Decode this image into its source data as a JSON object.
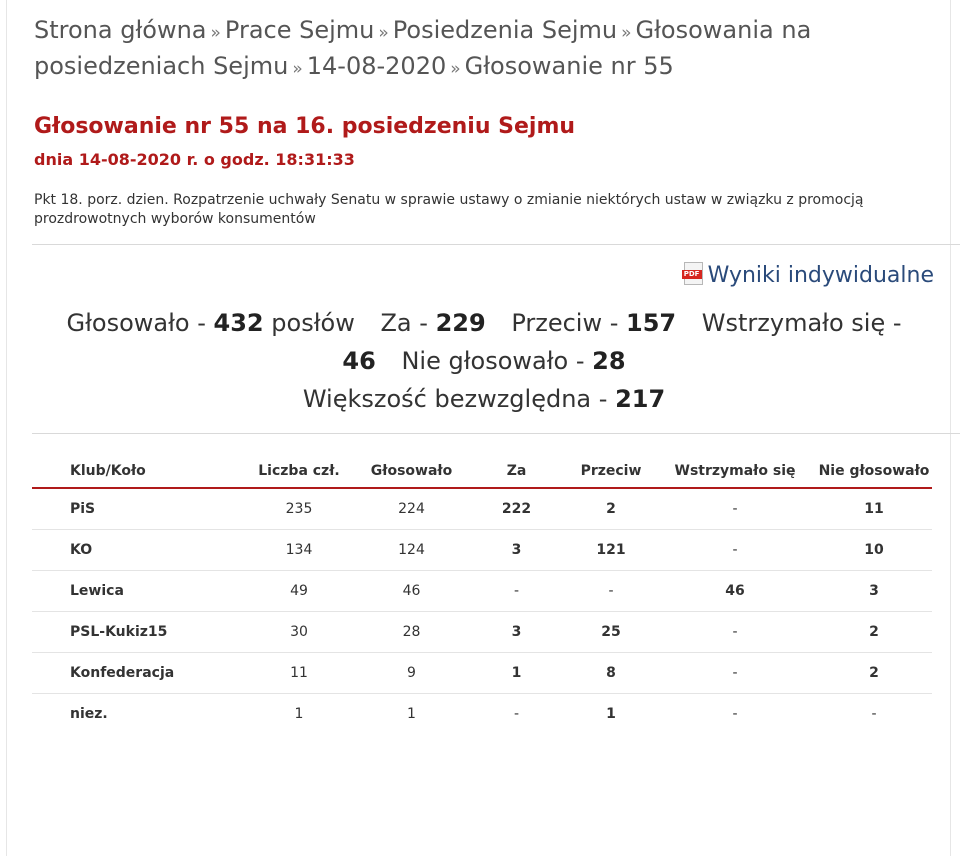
{
  "breadcrumb": {
    "items": [
      "Strona główna",
      "Prace Sejmu",
      "Posiedzenia Sejmu",
      "Głosowania na posiedzeniach Sejmu",
      "14-08-2020",
      "Głosowanie nr 55"
    ],
    "separator": "»"
  },
  "vote": {
    "title": "Głosowanie nr 55 na 16. posiedzeniu Sejmu",
    "date_line": "dnia 14-08-2020 r. o godz. 18:31:33",
    "description": "Pkt 18. porz. dzien. Rozpatrzenie uchwały Senatu w sprawie ustawy o zmianie niektórych ustaw w związku z promocją prozdrowotnych wyborów konsumentów"
  },
  "pdf_link": {
    "icon": "pdf-icon",
    "icon_text": "PDF",
    "label": "Wyniki indywidualne"
  },
  "summary": {
    "voted_label": "Głosowało -",
    "voted": "432",
    "voted_unit": "posłów",
    "for_label": "Za -",
    "for": "229",
    "against_label": "Przeciw -",
    "against": "157",
    "abstained_label": "Wstrzymało się -",
    "abstained": "46",
    "not_voted_label": "Nie głosowało -",
    "not_voted": "28",
    "majority_label": "Większość bezwzględna -",
    "majority": "217"
  },
  "table": {
    "headers": [
      "Klub/Koło",
      "Liczba czł.",
      "Głosowało",
      "Za",
      "Przeciw",
      "Wstrzymało się",
      "Nie głosowało"
    ],
    "rows": [
      [
        "PiS",
        "235",
        "224",
        "222",
        "2",
        "-",
        "11"
      ],
      [
        "KO",
        "134",
        "124",
        "3",
        "121",
        "-",
        "10"
      ],
      [
        "Lewica",
        "49",
        "46",
        "-",
        "-",
        "46",
        "3"
      ],
      [
        "PSL-Kukiz15",
        "30",
        "28",
        "3",
        "25",
        "-",
        "2"
      ],
      [
        "Konfederacja",
        "11",
        "9",
        "1",
        "8",
        "-",
        "2"
      ],
      [
        "niez.",
        "1",
        "1",
        "-",
        "1",
        "-",
        "-"
      ]
    ]
  },
  "colors": {
    "title_red": "#b01a1a",
    "link_blue": "#2a4a7a",
    "header_rule": "#b01a1a"
  }
}
